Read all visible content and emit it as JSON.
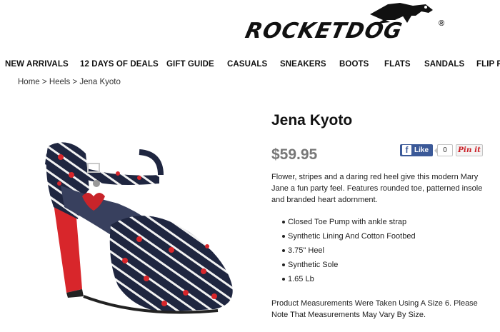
{
  "brand": {
    "name": "ROCKETDOG",
    "reg_mark": "®"
  },
  "nav": {
    "items": [
      {
        "label": "NEW ARRIVALS"
      },
      {
        "label": "12 DAYS OF DEALS"
      },
      {
        "label": "GIFT GUIDE"
      },
      {
        "label": "CASUALS"
      },
      {
        "label": "SNEAKERS"
      },
      {
        "label": "BOOTS"
      },
      {
        "label": "FLATS"
      },
      {
        "label": "SANDALS"
      },
      {
        "label": "FLIP F"
      }
    ]
  },
  "breadcrumb": {
    "home": "Home",
    "sep": ">",
    "category": "Heels",
    "current": "Jena Kyoto"
  },
  "product": {
    "title": "Jena Kyoto",
    "price": "$59.95",
    "description": "Flower, stripes and a daring red heel give this modern Mary Jane a fun party feel. Features rounded toe, patterned insole and branded heart adornment.",
    "features": [
      "Closed Toe Pump with ankle strap",
      "Synthetic Lining And Cotton Footbed",
      "3.75\" Heel",
      "Synthetic Sole",
      "1.65 Lb"
    ],
    "note": "Product Measurements Were Taken Using A Size 6. Please Note That Measurements May Vary By Size.",
    "image_icon": "shoe-photo"
  },
  "social": {
    "like_label": "Like",
    "like_count": "0",
    "pin_label": "Pin it",
    "fb_icon": "f"
  },
  "colors": {
    "navy": "#1f2640",
    "red": "#d8262b",
    "price_gray": "#777777",
    "facebook": "#3b5998"
  }
}
